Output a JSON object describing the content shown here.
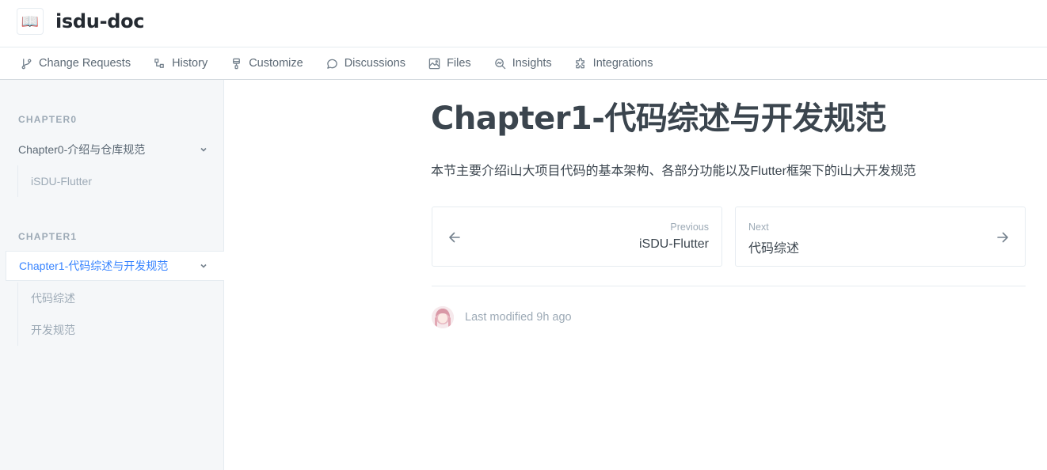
{
  "header": {
    "logo_icon": "open-book-icon",
    "logo_glyph": "📖",
    "title": "isdu-doc"
  },
  "tabs": [
    {
      "label": "Change Requests",
      "icon": "branch-icon"
    },
    {
      "label": "History",
      "icon": "history-icon"
    },
    {
      "label": "Customize",
      "icon": "paintbrush-icon"
    },
    {
      "label": "Discussions",
      "icon": "chat-bubble-icon"
    },
    {
      "label": "Files",
      "icon": "image-file-icon"
    },
    {
      "label": "Insights",
      "icon": "insights-icon"
    },
    {
      "label": "Integrations",
      "icon": "puzzle-icon"
    }
  ],
  "sidebar": {
    "sections": [
      {
        "title": "CHAPTER0",
        "group": "Chapter0-介绍与仓库规范",
        "items": [
          "iSDU-Flutter"
        ]
      },
      {
        "title": "CHAPTER1",
        "group": "Chapter1-代码综述与开发规范",
        "items": [
          "代码综述",
          "开发规范"
        ]
      }
    ]
  },
  "main": {
    "title": "Chapter1-代码综述与开发规范",
    "description": "本节主要介绍i山大项目代码的基本架构、各部分功能以及Flutter框架下的i山大开发规范",
    "prev": {
      "caption": "Previous",
      "title": "iSDU-Flutter"
    },
    "next": {
      "caption": "Next",
      "title": "代码综述"
    },
    "last_modified": "Last modified 9h ago"
  },
  "colors": {
    "accent": "#3884ff",
    "text": "#3b454e",
    "muted": "#9daab6",
    "sidebar_bg": "#f5f7f9",
    "border": "#e6ecf1"
  }
}
